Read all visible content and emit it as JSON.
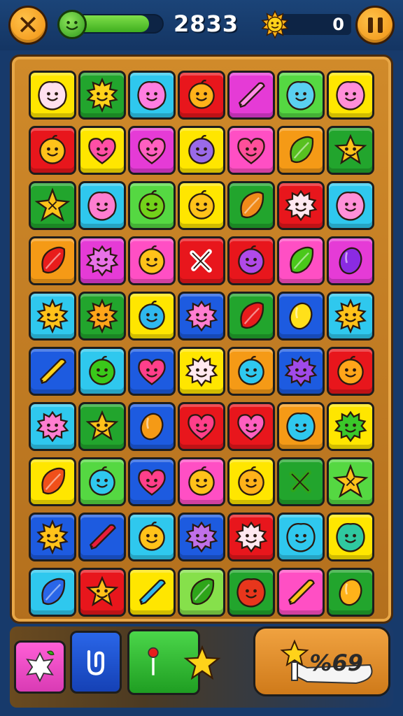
{
  "top_bar": {
    "score": "2833",
    "coin_count": "0",
    "progress": 0.85,
    "icons": {
      "close": "close-icon",
      "pause": "pause-icon",
      "progress_face": "green-face-icon",
      "coin": "sun-face-icon"
    }
  },
  "colors": {
    "yellow": "#ffe600",
    "green": "#22a52d",
    "lime": "#55d842",
    "cyan": "#2fc8ee",
    "red": "#e8161c",
    "magenta": "#e53bd6",
    "pink": "#ff4fc4",
    "orange": "#f59a16",
    "blue": "#1d5be0",
    "purple": "#8a2be2",
    "lightgreen": "#86e04b"
  },
  "board": {
    "rows": [
      [
        [
          "yellow",
          "blob-face-icon",
          "#ffe0ee"
        ],
        [
          "green",
          "sun-face-icon",
          "#ffd21a"
        ],
        [
          "cyan",
          "blob-face-icon",
          "#ff7ee0"
        ],
        [
          "red",
          "round-face-icon",
          "#ffb21a"
        ],
        [
          "magenta",
          "crayon-icon",
          "#ff8de6"
        ],
        [
          "lime",
          "blob-face-icon",
          "#5ad0f0"
        ],
        [
          "yellow",
          "blob-face-icon",
          "#ff8ed8"
        ]
      ],
      [
        [
          "red",
          "round-face-icon",
          "#ffc21a"
        ],
        [
          "yellow",
          "heart-face-icon",
          "#ff4fa5"
        ],
        [
          "magenta",
          "heart-face-icon",
          "#ff5fc0"
        ],
        [
          "yellow",
          "round-face-icon",
          "#9a6ae8"
        ],
        [
          "pink",
          "heart-face-icon",
          "#ff4f9a"
        ],
        [
          "orange",
          "leaf-icon",
          "#58c020"
        ],
        [
          "green",
          "star-face-icon",
          "#ffc21a"
        ]
      ],
      [
        [
          "green",
          "star-icon",
          "#ffc21a"
        ],
        [
          "cyan",
          "blob-face-icon",
          "#ff7ed0"
        ],
        [
          "lime",
          "round-face-icon",
          "#72d21a"
        ],
        [
          "yellow",
          "round-face-icon",
          "#ffc21a"
        ],
        [
          "green",
          "leaf-icon",
          "#f08a1a"
        ],
        [
          "red",
          "splat-face-icon",
          "#ffe8f0"
        ],
        [
          "cyan",
          "blob-face-icon",
          "#ff90d8"
        ]
      ],
      [
        [
          "orange",
          "leaf-icon",
          "#e81c1c"
        ],
        [
          "magenta",
          "splat-face-icon",
          "#e872e8"
        ],
        [
          "pink",
          "round-face-icon",
          "#ffc21a"
        ],
        [
          "red",
          "crossed-icon",
          "#ffffff"
        ],
        [
          "red",
          "round-face-icon",
          "#b04ae8"
        ],
        [
          "pink",
          "leaf-icon",
          "#4ac81a"
        ],
        [
          "magenta",
          "egg-icon",
          "#8a2be2"
        ]
      ],
      [
        [
          "cyan",
          "sun-face-icon",
          "#ffc21a"
        ],
        [
          "green",
          "sun-face-icon",
          "#ffa51a"
        ],
        [
          "yellow",
          "round-face-icon",
          "#2fb8ee"
        ],
        [
          "blue",
          "splat-face-icon",
          "#ff7ed0"
        ],
        [
          "green",
          "leaf-icon",
          "#e81c1c"
        ],
        [
          "blue",
          "egg-icon",
          "#ffe01a"
        ],
        [
          "cyan",
          "sun-face-icon",
          "#ffc21a"
        ]
      ],
      [
        [
          "blue",
          "crayon-icon",
          "#ffd21a"
        ],
        [
          "cyan",
          "round-face-icon",
          "#3ac81a"
        ],
        [
          "blue",
          "heart-face-icon",
          "#ff3f8a"
        ],
        [
          "yellow",
          "splat-face-icon",
          "#ffe8f0"
        ],
        [
          "orange",
          "round-face-icon",
          "#2fc8ee"
        ],
        [
          "blue",
          "splat-face-icon",
          "#a04ae8"
        ],
        [
          "red",
          "round-face-icon",
          "#ffa51a"
        ]
      ],
      [
        [
          "cyan",
          "splat-face-icon",
          "#ff7ed0"
        ],
        [
          "green",
          "star-face-icon",
          "#ffc21a"
        ],
        [
          "blue",
          "egg-icon",
          "#f59a16"
        ],
        [
          "red",
          "heart-face-icon",
          "#ff3f8a"
        ],
        [
          "red",
          "heart-face-icon",
          "#ff5fc0"
        ],
        [
          "orange",
          "blob-face-icon",
          "#2fc8ee"
        ],
        [
          "yellow",
          "splat-face-icon",
          "#3ac82a"
        ]
      ],
      [
        [
          "yellow",
          "leaf-icon",
          "#f0501a"
        ],
        [
          "lime",
          "round-face-icon",
          "#2fc8ee"
        ],
        [
          "blue",
          "heart-face-icon",
          "#ff3f8a"
        ],
        [
          "pink",
          "round-face-icon",
          "#ffc21a"
        ],
        [
          "yellow",
          "round-face-icon",
          "#ffb21a"
        ],
        [
          "green",
          "crossed-icon",
          "#2ea51a"
        ],
        [
          "lime",
          "star-icon",
          "#ffc21a"
        ]
      ],
      [
        [
          "blue",
          "sun-face-icon",
          "#ffc21a"
        ],
        [
          "blue",
          "crayon-icon",
          "#e81c3c"
        ],
        [
          "cyan",
          "round-face-icon",
          "#ffc21a"
        ],
        [
          "blue",
          "splat-face-icon",
          "#c070e8"
        ],
        [
          "red",
          "splat-face-icon",
          "#ffe8f0"
        ],
        [
          "cyan",
          "blob-face-icon",
          "#2fc8ee"
        ],
        [
          "yellow",
          "blob-face-icon",
          "#2fc8a0"
        ]
      ],
      [
        [
          "cyan",
          "leaf-icon",
          "#2a66e8"
        ],
        [
          "red",
          "star-face-icon",
          "#ffc21a"
        ],
        [
          "yellow",
          "crayon-icon",
          "#2fb8ee"
        ],
        [
          "lightgreen",
          "leaf-icon",
          "#2ea51a"
        ],
        [
          "green",
          "blob-face-icon",
          "#e8361c"
        ],
        [
          "pink",
          "crayon-icon",
          "#ffc21a"
        ],
        [
          "green",
          "egg-icon",
          "#ffb21a"
        ]
      ]
    ]
  },
  "bottom_bar": {
    "reward_text": "%69",
    "boosters": {
      "pink": "flower-icon",
      "blue": "magnet-icon",
      "green": "pin-icon",
      "star": "star-icon",
      "reward": "star-arrow-icon"
    }
  }
}
